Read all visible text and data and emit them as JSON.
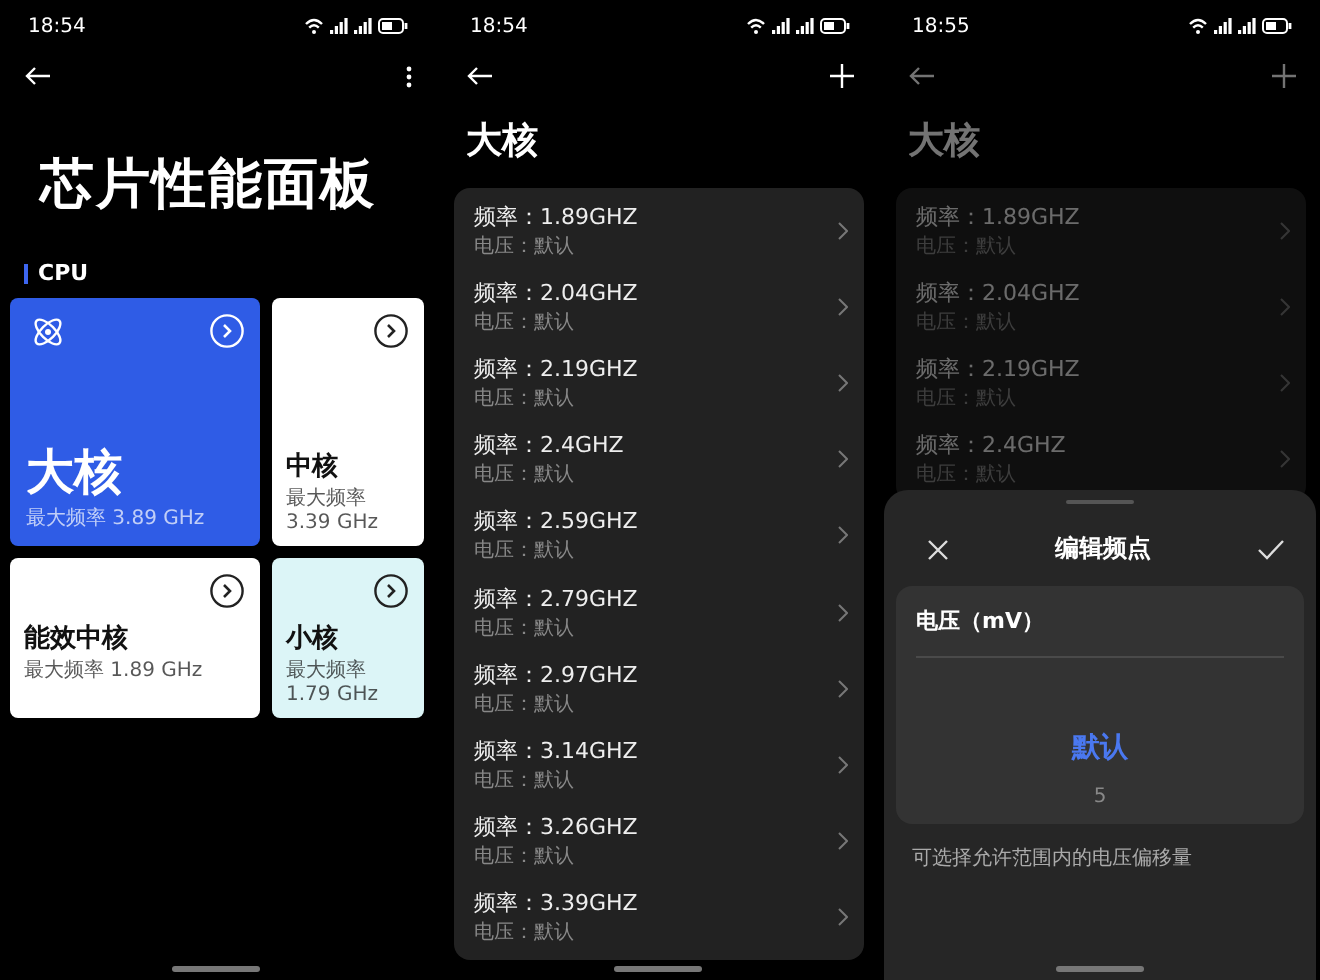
{
  "screens": [
    {
      "kind": "dashboard",
      "time": "18:54",
      "title": "芯片性能面板",
      "section": "CPU",
      "cards": [
        {
          "name": "大核",
          "detail": "最大频率 3.89 GHz",
          "color": "#2f5ce6"
        },
        {
          "name": "中核",
          "detail": "最大频率 3.39 GHz",
          "color": "#ffffff"
        },
        {
          "name": "能效中核",
          "detail": "最大频率 1.89 GHz",
          "color": "#ffffff"
        },
        {
          "name": "小核",
          "detail": "最大频率 1.79 GHz",
          "color": "#dcf5f7"
        }
      ]
    },
    {
      "kind": "list",
      "time": "18:54",
      "title": "大核",
      "rows": [
        {
          "frequency": "频率：1.89GHZ",
          "voltage": "电压：默认"
        },
        {
          "frequency": "频率：2.04GHZ",
          "voltage": "电压：默认"
        },
        {
          "frequency": "频率：2.19GHZ",
          "voltage": "电压：默认"
        },
        {
          "frequency": "频率：2.4GHZ",
          "voltage": "电压：默认"
        },
        {
          "frequency": "频率：2.59GHZ",
          "voltage": "电压：默认"
        },
        {
          "frequency": "频率：2.79GHZ",
          "voltage": "电压：默认"
        },
        {
          "frequency": "频率：2.97GHZ",
          "voltage": "电压：默认"
        },
        {
          "frequency": "频率：3.14GHZ",
          "voltage": "电压：默认"
        },
        {
          "frequency": "频率：3.26GHZ",
          "voltage": "电压：默认"
        },
        {
          "frequency": "频率：3.39GHZ",
          "voltage": "电压：默认"
        }
      ]
    },
    {
      "kind": "list",
      "time": "18:55",
      "title": "大核",
      "rows": [
        {
          "frequency": "频率：1.89GHZ",
          "voltage": "电压：默认"
        },
        {
          "frequency": "频率：2.04GHZ",
          "voltage": "电压：默认"
        },
        {
          "frequency": "频率：2.19GHZ",
          "voltage": "电压：默认"
        },
        {
          "frequency": "频率：2.4GHZ",
          "voltage": "电压：默认"
        }
      ],
      "sheet": {
        "title": "编辑频点",
        "field_label": "电压（mV）",
        "options": [
          {
            "label": "默认",
            "selected": true
          },
          {
            "label": "5",
            "selected": false
          }
        ],
        "hint": "可选择允许范围内的电压偏移量"
      }
    }
  ]
}
